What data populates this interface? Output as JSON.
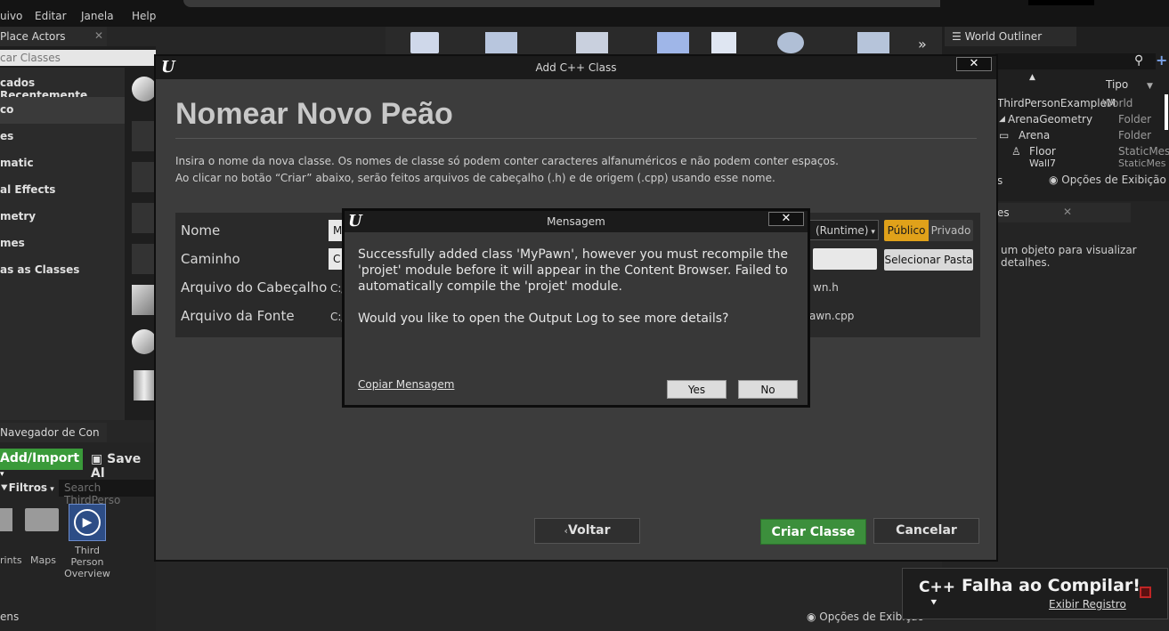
{
  "menu": [
    "uivo",
    "Editar",
    "Janela",
    "Help"
  ],
  "place_actors": {
    "tab_label": "Place Actors",
    "search_placeholder": "car Classes",
    "categories": [
      "cados Recentemente",
      "co",
      "es",
      "matic",
      "al Effects",
      "metry",
      "mes",
      "as as Classes"
    ],
    "selected_index": 1
  },
  "toolbar_more": "»",
  "content_browser": {
    "tab_label": "Navegador de Con",
    "add_import": "Add/Import",
    "save_all": "Save Al",
    "filters": "Filtros",
    "search_placeholder": "Search ThirdPerso",
    "items": [
      "rints",
      "Maps",
      "Third Person Overview"
    ],
    "footer_left": "ens",
    "view_options": "Opções de Exibição"
  },
  "world_outliner": {
    "tab_label": "World Outliner",
    "col_type": "Tipo",
    "rows": [
      {
        "name": "ThirdPersonExampleM",
        "type": "World"
      },
      {
        "name": "ArenaGeometry",
        "type": "Folder"
      },
      {
        "name": "Arena",
        "type": "Folder"
      },
      {
        "name": "Floor",
        "type": "StaticMesh/"
      },
      {
        "name": "Wall7",
        "type": "StaticMesh/"
      }
    ],
    "count_text": "s",
    "view_options": "Opções de Exibição"
  },
  "details": {
    "tab_label": "es",
    "hint": "um objeto para visualizar detalhes."
  },
  "cpp_dialog": {
    "title": "Add C++ Class",
    "heading": "Nomear Novo Peão",
    "desc1": "Insira o nome da nova classe. Os nomes de classe só podem conter caracteres alfanuméricos e não podem conter espaços.",
    "desc2": "Ao clicar no botão “Criar” abaixo, serão feitos arquivos de cabeçalho (.h) e de origem (.cpp) usando esse nome.",
    "labels": {
      "name": "Nome",
      "path": "Caminho",
      "header": "Arquivo do Cabeçalho",
      "source": "Arquivo da Fonte"
    },
    "name_value_prefix": "M",
    "path_value_prefix": "C",
    "header_prefix": "C:/",
    "header_suffix": "wn.h",
    "source_prefix": "C:/",
    "source_suffix": "awn.cpp",
    "runtime": "(Runtime)",
    "public": "Público",
    "private": "Privado",
    "select_folder": "Selecionar Pasta",
    "back": "Voltar",
    "create": "Criar Classe",
    "cancel": "Cancelar"
  },
  "message_dialog": {
    "title": "Mensagem",
    "text1": "Successfully added class 'MyPawn', however you must recompile the 'projet' module before it will appear in the Content Browser. Failed to automatically compile the 'projet' module.",
    "text2": "Would you like to open the Output Log to see more details?",
    "copy": "Copiar Mensagem",
    "yes": "Yes",
    "no": "No"
  },
  "toast": {
    "badge": "C++",
    "title": "Falha ao Compilar!",
    "link": "Exibir Registro"
  },
  "colors": {
    "accent_yellow": "#e0a11a",
    "create_green": "#3c8f3c",
    "add_import_green": "#3a9a3a"
  }
}
